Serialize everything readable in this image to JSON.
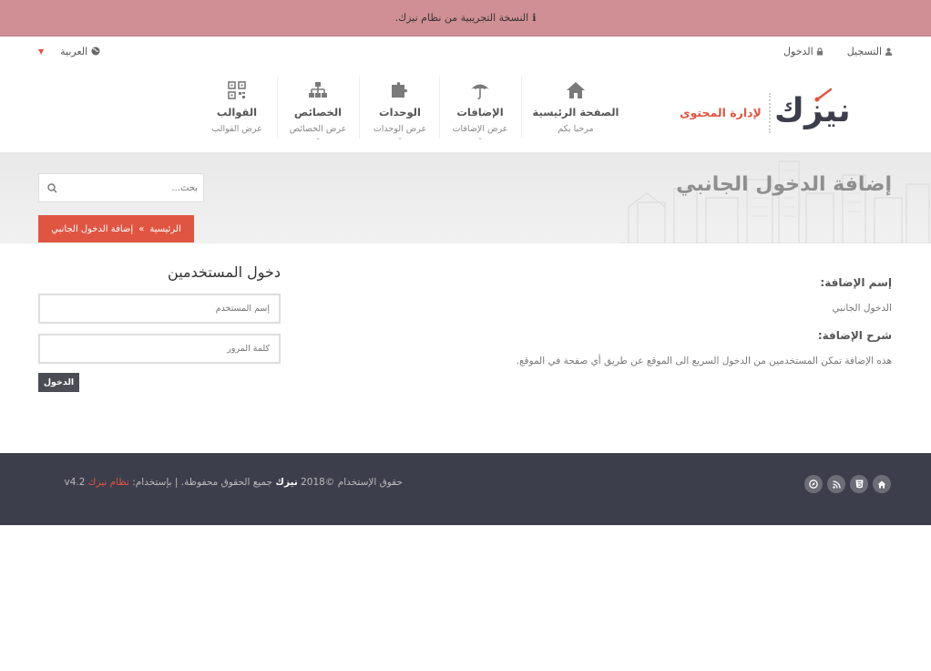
{
  "trial_banner": {
    "text": "النسخة التجريبية من نظام نيزك."
  },
  "top_links": {
    "register": "التسجيل",
    "login": "الدخول",
    "language": "العربية"
  },
  "brand": {
    "logo_text": "نيزك",
    "tagline": "لإدارة المحتوى"
  },
  "nav": {
    "home": {
      "title": "الصفحة الرئيسية",
      "sub": "مرحبا بكم"
    },
    "plugins": {
      "title": "الإضافات",
      "sub": "عرض الإضافات"
    },
    "modules": {
      "title": "الوحدات",
      "sub": "عرض الوحدات"
    },
    "properties": {
      "title": "الخصائص",
      "sub": "عرض الخصائص"
    },
    "templates": {
      "title": "القوالب",
      "sub": "عرض القوالب"
    }
  },
  "hero": {
    "title": "إضافة الدخول الجانبي"
  },
  "search": {
    "placeholder": "بحث..."
  },
  "breadcrumb": {
    "home": "الرئيسية",
    "separator": "»",
    "current": "إضافة الدخول الجانبي"
  },
  "plugin_info": {
    "name_label": "إسم الإضافة:",
    "name_value": "الدخول الجانبي",
    "desc_label": "شرح الإضافة:",
    "desc_value": "هذه الإضافة تمكن المستخدمين من الدخول السريع الى الموقع عن طريق أي صفحة في الموقع."
  },
  "login_form": {
    "title": "دخول المستخدمين",
    "username_placeholder": "إسم المستخدم",
    "password_placeholder": "كلمة المرور",
    "submit_label": "الدخول"
  },
  "footer": {
    "rights_prefix": "حقوق الإستخدام ©2018",
    "brand": "نيزك",
    "rights_suffix": "جميع الحقوق محفوظة. | بإستخدام:",
    "system_link": "نظام نيزك",
    "version": "v4.2"
  },
  "colors": {
    "trial_bg": "#d08f94",
    "accent": "#e05541",
    "footer_bg": "#3d3e4b",
    "button_dark": "#4b4d55"
  }
}
